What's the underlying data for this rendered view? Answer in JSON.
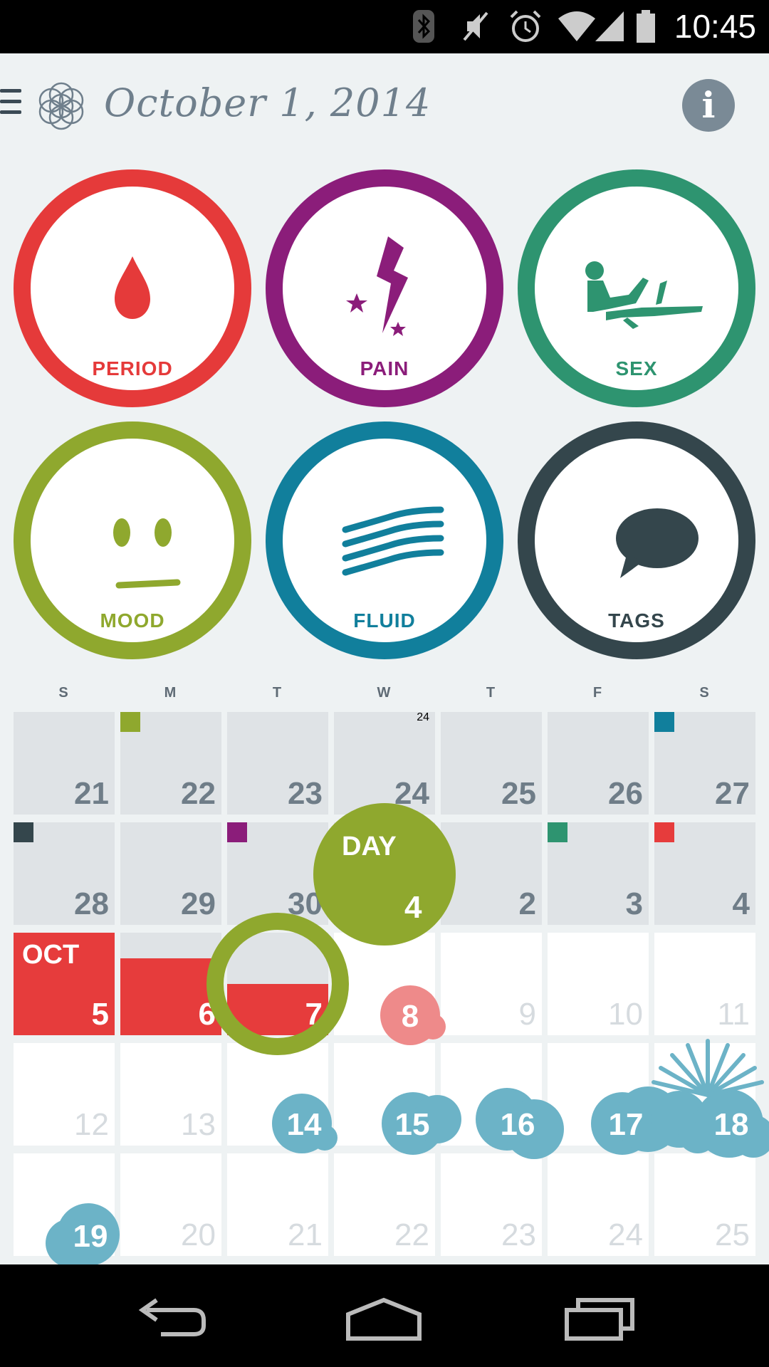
{
  "status_bar": {
    "time": "10:45",
    "icons": [
      "bluetooth-icon",
      "mute-icon",
      "alarm-icon",
      "wifi-icon",
      "signal-icon",
      "battery-icon"
    ]
  },
  "header": {
    "date": "October 1, 2014",
    "menu_icon": "hamburger-icon",
    "logo_icon": "flower-of-life-logo",
    "info_icon": "info-icon",
    "info_glyph": "i"
  },
  "trackers": [
    {
      "label": "PERIOD",
      "color": "#e53a3a",
      "icon": "blood-drop-icon"
    },
    {
      "label": "PAIN",
      "color": "#8b1d7a",
      "icon": "lightning-icon"
    },
    {
      "label": "SEX",
      "color": "#2e9470",
      "icon": "reclining-figure-icon"
    },
    {
      "label": "MOOD",
      "color": "#8fa82e",
      "icon": "neutral-face-icon"
    },
    {
      "label": "FLUID",
      "color": "#117f9c",
      "icon": "waves-icon"
    },
    {
      "label": "TAGS",
      "color": "#34464c",
      "icon": "speech-bubble-icon"
    }
  ],
  "calendar": {
    "weekdays": [
      "S",
      "M",
      "T",
      "W",
      "T",
      "F",
      "S"
    ],
    "month_label": "OCT",
    "weeks": [
      [
        "21",
        "22",
        "23",
        "24",
        "25",
        "26",
        "27"
      ],
      [
        "28",
        "29",
        "30",
        "",
        "2",
        "3",
        "4"
      ],
      [
        "5",
        "6",
        "7",
        "8",
        "9",
        "10",
        "11"
      ],
      [
        "12",
        "13",
        "14",
        "15",
        "16",
        "17",
        "18"
      ],
      [
        "19",
        "20",
        "21",
        "22",
        "23",
        "24",
        "25"
      ]
    ],
    "current_day": {
      "label": "DAY",
      "value": "4"
    },
    "colors": {
      "period": "#e63c3c",
      "fertile": "#6cb3c7",
      "predicted_period": "#ee8a8a",
      "mood": "#8fa82e",
      "fluid": "#117f9c",
      "pain": "#8b1d7a",
      "sex": "#2e9470",
      "tags": "#34464c"
    }
  },
  "nav_bar": {
    "icons": [
      "back-icon",
      "home-icon",
      "recent-apps-icon"
    ]
  }
}
